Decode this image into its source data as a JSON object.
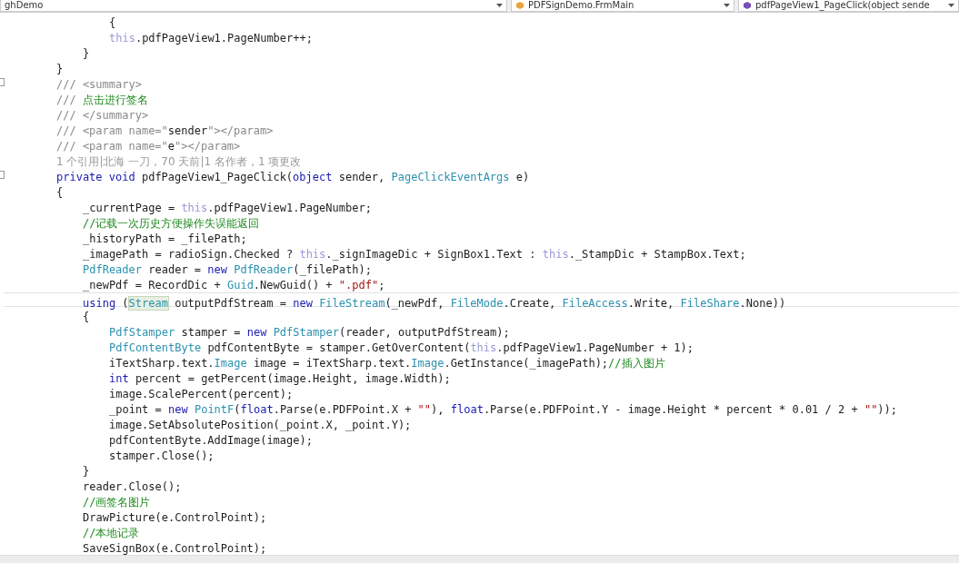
{
  "navigation_bar": [
    {
      "text": "ghDemo"
    },
    {
      "text": "PDFSignDemo.FrmMain"
    },
    {
      "text": "pdfPageView1_PageClick(object sende"
    }
  ],
  "code_lines": [
    {
      "children": [
        {
          "children": [
            {
              "kind": "code",
              "fold": false,
              "current": false,
              "tokens": [
                {
                  "kind": "plain",
                  "text": "{"
                }
              ]
            },
            {
              "kind": "code",
              "fold": false,
              "current": false,
              "tokens": [
                {
                  "kind": "this",
                  "text": "this"
                },
                {
                  "kind": "plain",
                  "text": ".pdfPageView1.PageNumber++;"
                }
              ]
            }
          ]
        },
        {
          "kind": "code",
          "fold": false,
          "current": false,
          "tokens": [
            {
              "kind": "plain",
              "text": "}"
            }
          ]
        }
      ]
    },
    {
      "kind": "code",
      "fold": false,
      "current": false,
      "tokens": [
        {
          "kind": "plain",
          "text": "}"
        }
      ]
    },
    {
      "kind": "code",
      "fold": true,
      "current": false,
      "tokens": [
        {
          "kind": "doc",
          "text": "/// <summary>"
        }
      ]
    },
    {
      "kind": "code",
      "fold": false,
      "current": false,
      "tokens": [
        {
          "kind": "doc",
          "text": "/// "
        },
        {
          "kind": "comment",
          "text": "点击进行签名"
        }
      ]
    },
    {
      "kind": "code",
      "fold": false,
      "current": false,
      "tokens": [
        {
          "kind": "doc",
          "text": "/// </summary>"
        }
      ]
    },
    {
      "kind": "code",
      "fold": false,
      "current": false,
      "tokens": [
        {
          "kind": "doc",
          "text": "/// <param name=\""
        },
        {
          "kind": "plain",
          "text": "sender"
        },
        {
          "kind": "doc",
          "text": "\"></param>"
        }
      ]
    },
    {
      "kind": "code",
      "fold": false,
      "current": false,
      "tokens": [
        {
          "kind": "doc",
          "text": "/// <param name=\""
        },
        {
          "kind": "plain",
          "text": "e"
        },
        {
          "kind": "doc",
          "text": "\"></param>"
        }
      ]
    },
    {
      "kind": "codelens",
      "fold": false,
      "current": false,
      "tokens": [
        {
          "kind": "plain",
          "text": "1 个引用|北海 一刀，70 天前|1 名作者，1 项更改"
        }
      ]
    },
    {
      "kind": "code",
      "fold": true,
      "current": false,
      "tokens": [
        {
          "kind": "keyword",
          "text": "private void"
        },
        {
          "kind": "plain",
          "text": " pdfPageView1_PageClick("
        },
        {
          "kind": "keyword",
          "text": "object"
        },
        {
          "kind": "plain",
          "text": " sender, "
        },
        {
          "kind": "type",
          "text": "PageClickEventArgs"
        },
        {
          "kind": "plain",
          "text": " e)"
        }
      ]
    },
    {
      "kind": "code",
      "fold": false,
      "current": false,
      "tokens": [
        {
          "kind": "plain",
          "text": "{"
        }
      ]
    },
    {
      "children": [
        {
          "kind": "code",
          "fold": false,
          "current": false,
          "tokens": [
            {
              "kind": "plain",
              "text": "_currentPage = "
            },
            {
              "kind": "this",
              "text": "this"
            },
            {
              "kind": "plain",
              "text": ".pdfPageView1.PageNumber;"
            }
          ]
        },
        {
          "kind": "code",
          "fold": false,
          "current": false,
          "tokens": [
            {
              "kind": "comment",
              "text": "//记载一次历史方便操作失误能返回"
            }
          ]
        },
        {
          "kind": "code",
          "fold": false,
          "current": false,
          "tokens": [
            {
              "kind": "plain",
              "text": "_historyPath = _filePath;"
            }
          ]
        },
        {
          "kind": "code",
          "fold": false,
          "current": false,
          "tokens": [
            {
              "kind": "plain",
              "text": "_imagePath = radioSign.Checked ? "
            },
            {
              "kind": "this",
              "text": "this"
            },
            {
              "kind": "plain",
              "text": "._signImageDic + SignBox1.Text : "
            },
            {
              "kind": "this",
              "text": "this"
            },
            {
              "kind": "plain",
              "text": "._StampDic + StampBox.Text;"
            }
          ]
        },
        {
          "kind": "code",
          "fold": false,
          "current": false,
          "tokens": [
            {
              "kind": "type",
              "text": "PdfReader"
            },
            {
              "kind": "plain",
              "text": " reader = "
            },
            {
              "kind": "keyword",
              "text": "new"
            },
            {
              "kind": "type",
              "text": " PdfReader"
            },
            {
              "kind": "plain",
              "text": "(_filePath);"
            }
          ]
        },
        {
          "kind": "code",
          "fold": false,
          "current": false,
          "tokens": [
            {
              "kind": "plain",
              "text": "_newPdf = RecordDic + "
            },
            {
              "kind": "type",
              "text": "Guid"
            },
            {
              "kind": "plain",
              "text": ".NewGuid() + "
            },
            {
              "kind": "string",
              "text": "\".pdf\""
            },
            {
              "kind": "plain",
              "text": ";"
            }
          ]
        },
        {
          "kind": "code",
          "fold": false,
          "current": true,
          "tokens": [
            {
              "kind": "keyword",
              "text": "using"
            },
            {
              "kind": "plain",
              "text": " ("
            },
            {
              "kind": "match",
              "text": "Stream"
            },
            {
              "kind": "plain",
              "text": " outputPdfStream = "
            },
            {
              "kind": "keyword",
              "text": "new"
            },
            {
              "kind": "type",
              "text": " FileStream"
            },
            {
              "kind": "plain",
              "text": "(_newPdf, "
            },
            {
              "kind": "type",
              "text": "FileMode"
            },
            {
              "kind": "plain",
              "text": ".Create, "
            },
            {
              "kind": "type",
              "text": "FileAccess"
            },
            {
              "kind": "plain",
              "text": ".Write, "
            },
            {
              "kind": "type",
              "text": "FileShare"
            },
            {
              "kind": "plain",
              "text": ".None))"
            }
          ]
        },
        {
          "kind": "code",
          "fold": false,
          "current": false,
          "tokens": [
            {
              "kind": "plain",
              "text": "{"
            }
          ]
        },
        {
          "children": [
            {
              "kind": "code",
              "fold": false,
              "current": false,
              "tokens": [
                {
                  "kind": "type",
                  "text": "PdfStamper"
                },
                {
                  "kind": "plain",
                  "text": " stamper = "
                },
                {
                  "kind": "keyword",
                  "text": "new"
                },
                {
                  "kind": "type",
                  "text": " PdfStamper"
                },
                {
                  "kind": "plain",
                  "text": "(reader, outputPdfStream);"
                }
              ]
            },
            {
              "kind": "code",
              "fold": false,
              "current": false,
              "tokens": [
                {
                  "kind": "type",
                  "text": "PdfContentByte"
                },
                {
                  "kind": "plain",
                  "text": " pdfContentByte = stamper.GetOverContent("
                },
                {
                  "kind": "this",
                  "text": "this"
                },
                {
                  "kind": "plain",
                  "text": ".pdfPageView1.PageNumber + 1);"
                }
              ]
            },
            {
              "kind": "code",
              "fold": false,
              "current": false,
              "tokens": [
                {
                  "kind": "plain",
                  "text": "iTextSharp.text."
                },
                {
                  "kind": "type",
                  "text": "Image"
                },
                {
                  "kind": "plain",
                  "text": " image = iTextSharp.text."
                },
                {
                  "kind": "type",
                  "text": "Image"
                },
                {
                  "kind": "plain",
                  "text": ".GetInstance(_imagePath);"
                },
                {
                  "kind": "comment",
                  "text": "//插入图片"
                }
              ]
            },
            {
              "kind": "code",
              "fold": false,
              "current": false,
              "tokens": [
                {
                  "kind": "keyword",
                  "text": "int"
                },
                {
                  "kind": "plain",
                  "text": " percent = getPercent(image.Height, image.Width);"
                }
              ]
            },
            {
              "kind": "code",
              "fold": false,
              "current": false,
              "tokens": [
                {
                  "kind": "plain",
                  "text": "image.ScalePercent(percent);"
                }
              ]
            },
            {
              "kind": "code",
              "fold": false,
              "current": false,
              "tokens": [
                {
                  "kind": "plain",
                  "text": "_point = "
                },
                {
                  "kind": "keyword",
                  "text": "new"
                },
                {
                  "kind": "type",
                  "text": " PointF"
                },
                {
                  "kind": "plain",
                  "text": "("
                },
                {
                  "kind": "keyword",
                  "text": "float"
                },
                {
                  "kind": "plain",
                  "text": ".Parse(e.PDFPoint.X + "
                },
                {
                  "kind": "string",
                  "text": "\"\""
                },
                {
                  "kind": "plain",
                  "text": "), "
                },
                {
                  "kind": "keyword",
                  "text": "float"
                },
                {
                  "kind": "plain",
                  "text": ".Parse(e.PDFPoint.Y - image.Height * percent * 0.01 / 2 + "
                },
                {
                  "kind": "string",
                  "text": "\"\""
                },
                {
                  "kind": "plain",
                  "text": "));"
                }
              ]
            },
            {
              "kind": "code",
              "fold": false,
              "current": false,
              "tokens": [
                {
                  "kind": "plain",
                  "text": "image.SetAbsolutePosition(_point.X, _point.Y);"
                }
              ]
            },
            {
              "kind": "code",
              "fold": false,
              "current": false,
              "tokens": [
                {
                  "kind": "plain",
                  "text": "pdfContentByte.AddImage(image);"
                }
              ]
            },
            {
              "kind": "code",
              "fold": false,
              "current": false,
              "tokens": [
                {
                  "kind": "plain",
                  "text": "stamper.Close();"
                }
              ]
            }
          ]
        },
        {
          "kind": "code",
          "fold": false,
          "current": false,
          "tokens": [
            {
              "kind": "plain",
              "text": "}"
            }
          ]
        },
        {
          "kind": "code",
          "fold": false,
          "current": false,
          "tokens": [
            {
              "kind": "plain",
              "text": "reader.Close();"
            }
          ]
        },
        {
          "kind": "code",
          "fold": false,
          "current": false,
          "tokens": [
            {
              "kind": "comment",
              "text": "//画签名图片"
            }
          ]
        },
        {
          "kind": "code",
          "fold": false,
          "current": false,
          "tokens": [
            {
              "kind": "plain",
              "text": "DrawPicture(e.ControlPoint);"
            }
          ]
        },
        {
          "kind": "code",
          "fold": false,
          "current": false,
          "tokens": [
            {
              "kind": "comment",
              "text": "//本地记录"
            }
          ]
        },
        {
          "kind": "code",
          "fold": false,
          "current": false,
          "tokens": [
            {
              "kind": "plain",
              "text": "SaveSignBox(e.ControlPoint);"
            }
          ]
        }
      ]
    }
  ]
}
